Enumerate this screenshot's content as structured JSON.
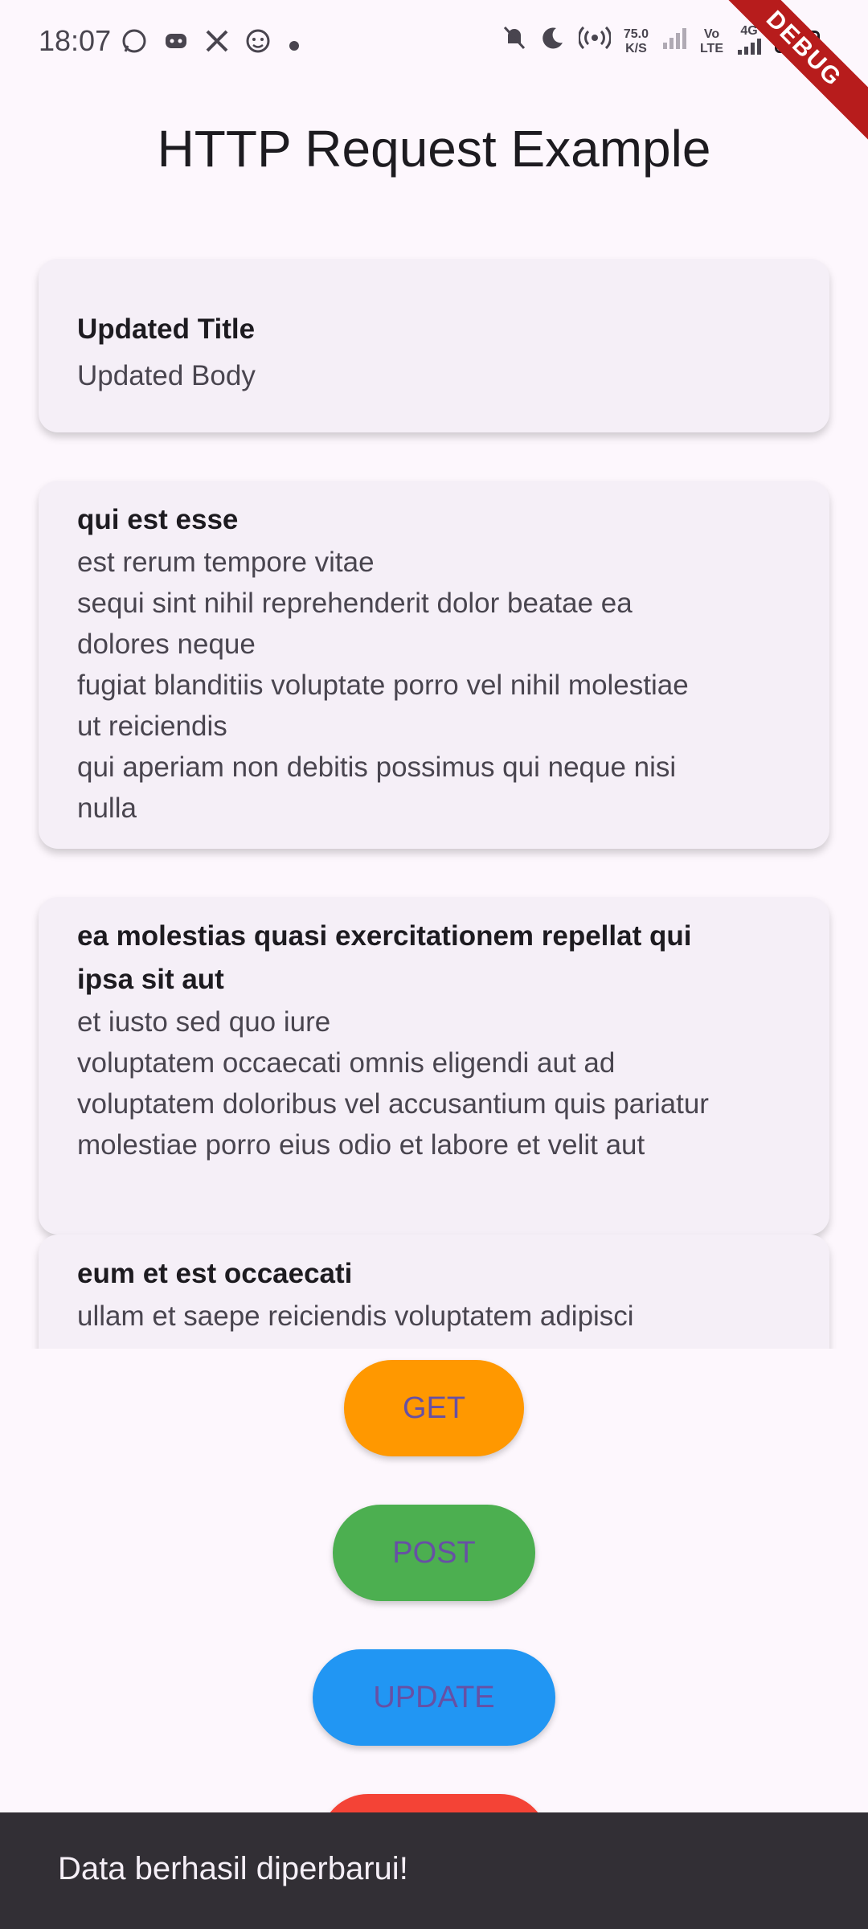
{
  "status_bar": {
    "time": "18:07",
    "net_speed_value": "75.0",
    "net_speed_unit": "K/S",
    "volte_top": "Vo",
    "volte_bottom": "LTE",
    "network_type": "4G",
    "battery_level": "4",
    "icons_left": [
      "whatsapp-icon",
      "discord-icon",
      "x-icon",
      "face-icon",
      "dot-icon"
    ],
    "icons_right": [
      "mute-icon",
      "moon-icon",
      "hotspot-icon",
      "signal-icon",
      "signal-icon",
      "battery-icon"
    ]
  },
  "debug_banner": "DEBUG",
  "page": {
    "title": "HTTP Request Example"
  },
  "posts": [
    {
      "title": "Updated Title",
      "body": "Updated Body"
    },
    {
      "title": "qui est esse",
      "body": "est rerum tempore vitae\nsequi sint nihil reprehenderit dolor beatae ea\ndolores neque\nfugiat blanditiis voluptate porro vel nihil molestiae\nut reiciendis\nqui aperiam non debitis possimus qui neque nisi\nnulla"
    },
    {
      "title": "ea molestias quasi exercitationem repellat qui\nipsa sit aut",
      "body": "et iusto sed quo iure\nvoluptatem occaecati omnis eligendi aut ad\nvoluptatem doloribus vel accusantium quis pariatur\nmolestiae porro eius odio et labore et velit aut"
    },
    {
      "title": "eum et est occaecati",
      "body": "ullam et saepe reiciendis voluptatem adipisci"
    }
  ],
  "buttons": {
    "get": {
      "label": "GET",
      "color": "#ff9800"
    },
    "post": {
      "label": "POST",
      "color": "#4caf50"
    },
    "update": {
      "label": "UPDATE",
      "color": "#2196f3"
    },
    "delete": {
      "color": "#f44336"
    }
  },
  "snackbar": {
    "message": "Data berhasil diperbarui!"
  }
}
